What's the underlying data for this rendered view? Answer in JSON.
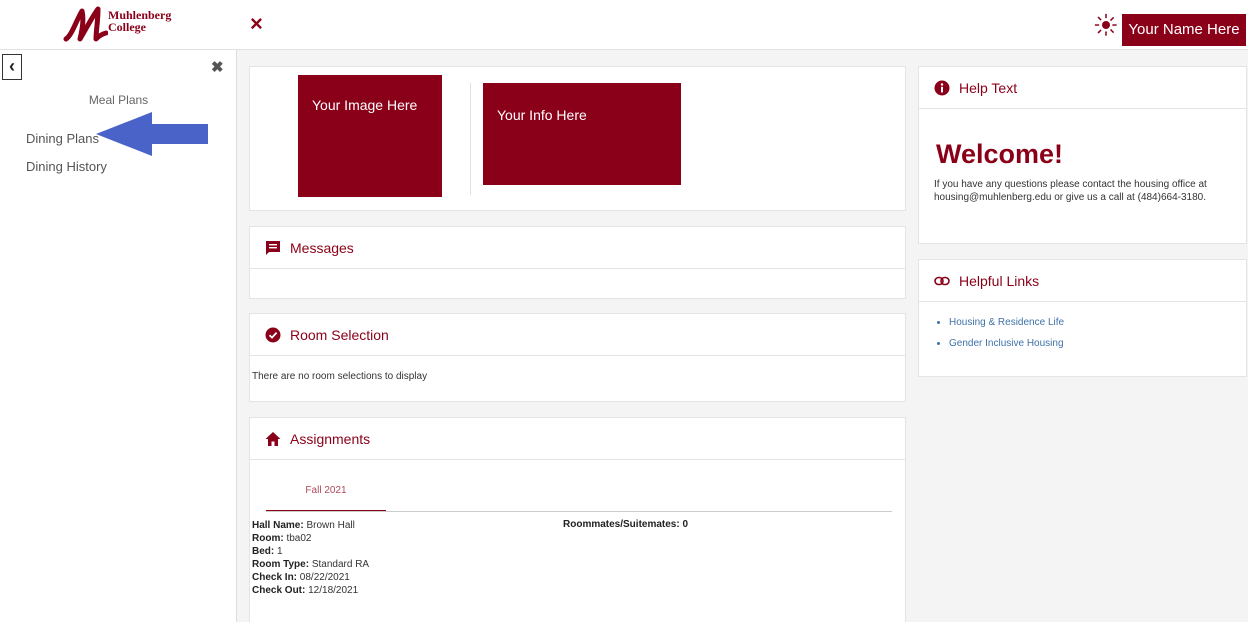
{
  "brand": {
    "line1": "Muhlenberg",
    "line2": "College"
  },
  "topbar": {
    "close_glyph": "×",
    "theme_icon": "sun-icon",
    "user_label": "Your Name Here"
  },
  "sidebar": {
    "back_glyph": "‹",
    "close_glyph": "✖",
    "title": "Meal Plans",
    "items": [
      {
        "label": "Dining Plans"
      },
      {
        "label": "Dining History"
      }
    ],
    "pointer_color": "#4a63c9"
  },
  "profile": {
    "image_label": "Your Image Here",
    "info_label": "Your Info Here"
  },
  "messages": {
    "title": "Messages"
  },
  "room_selection": {
    "title": "Room Selection",
    "empty_text": "There are no room selections to display"
  },
  "assignments": {
    "title": "Assignments",
    "tab": "Fall 2021",
    "details": [
      {
        "label": "Hall Name:",
        "value": "Brown Hall"
      },
      {
        "label": "Room:",
        "value": "tba02"
      },
      {
        "label": "Bed:",
        "value": "1"
      },
      {
        "label": "Room Type:",
        "value": "Standard RA"
      },
      {
        "label": "Check In:",
        "value": "08/22/2021"
      },
      {
        "label": "Check Out:",
        "value": "12/18/2021"
      }
    ],
    "roommates_label": "Roommates/Suitemates:",
    "roommates_value": "0"
  },
  "help": {
    "title": "Help Text",
    "heading": "Welcome!",
    "body": "If you have any questions please contact the housing office at housing@muhlenberg.edu or give us a call at (484)664-3180."
  },
  "links": {
    "title": "Helpful Links",
    "items": [
      {
        "label": "Housing & Residence Life"
      },
      {
        "label": "Gender Inclusive Housing"
      }
    ]
  },
  "colors": {
    "brand": "#8b0019",
    "link": "#3f72a8",
    "background": "#f4f4f4"
  }
}
